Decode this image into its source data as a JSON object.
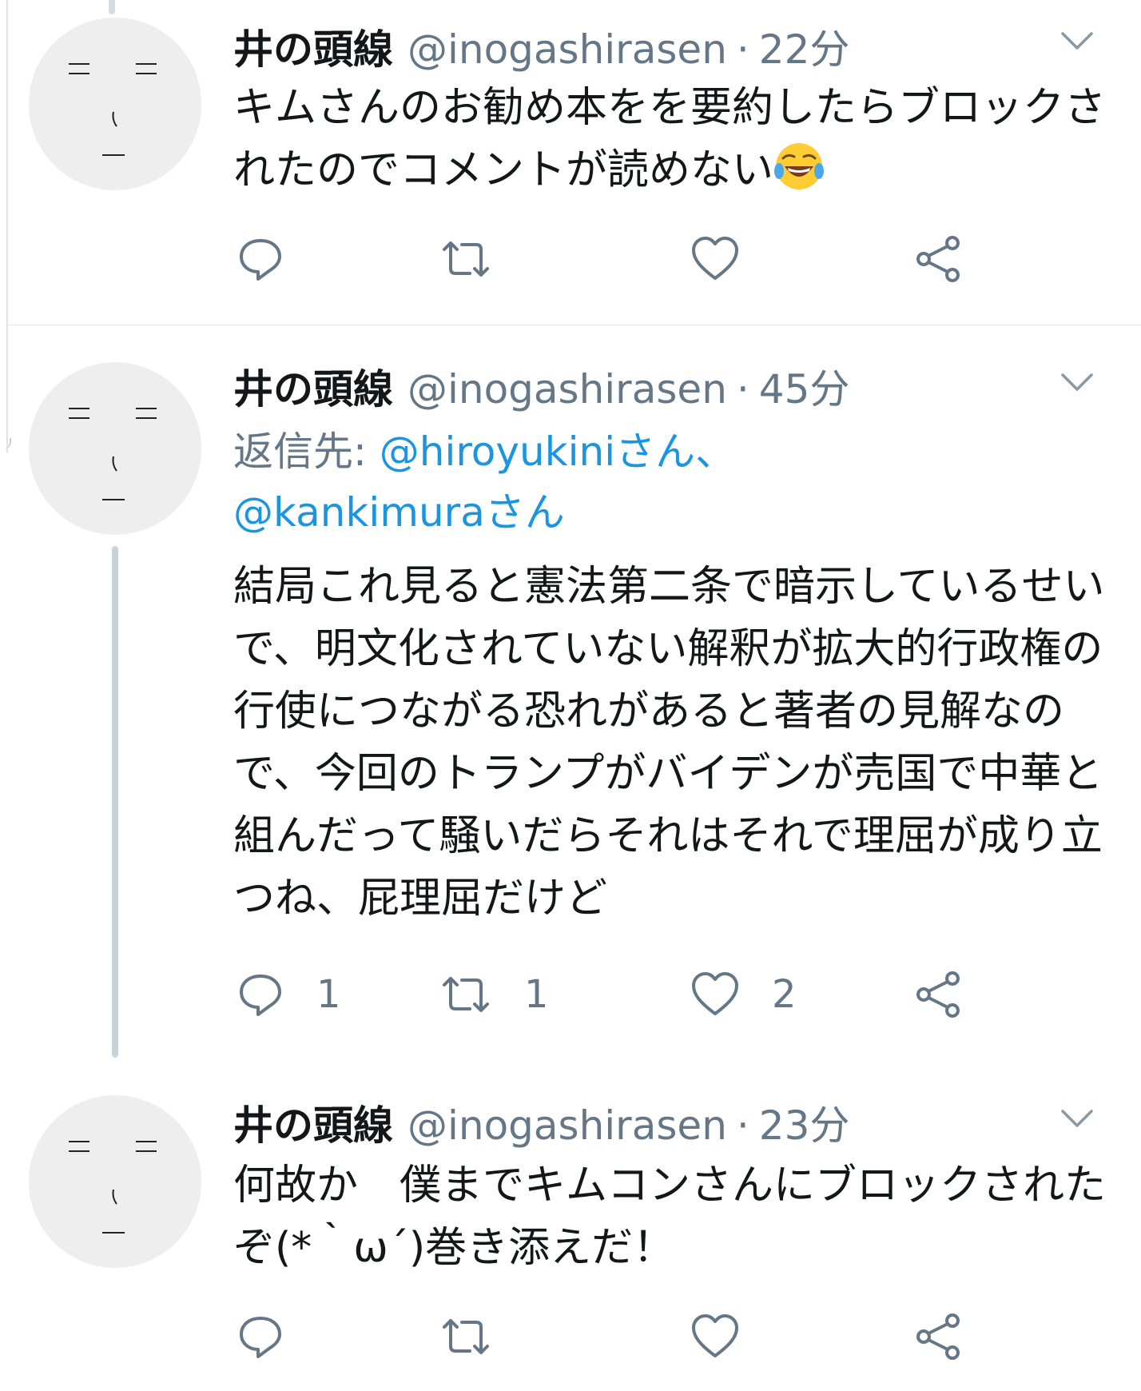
{
  "tweets": [
    {
      "name": "井の頭線",
      "handle": "@inogashirasen",
      "dot": "·",
      "time": "22分",
      "text": "キムさんのお勧め本をを要約したらブロックされたのでコメントが読めない",
      "emoji": "face-with-tears-of-joy",
      "actions": {
        "reply": "",
        "retweet": "",
        "like": "",
        "share": ""
      }
    },
    {
      "name": "井の頭線",
      "handle": "@inogashirasen",
      "dot": "·",
      "time": "45分",
      "reply_prefix": "返信先: ",
      "reply_mention_1": "@hiroyukiniさん、",
      "reply_mention_2": "@kankimuraさん",
      "text": "結局これ見ると憲法第二条で暗示しているせいで、明文化されていない解釈が拡大的行政権の行使につながる恐れがあると著者の見解なので、今回のトランプがバイデンが売国で中華と組んだって騒いだらそれはそれで理屈が成り立つね、屁理屈だけど",
      "actions": {
        "reply": "1",
        "retweet": "1",
        "like": "2",
        "share": ""
      }
    },
    {
      "name": "井の頭線",
      "handle": "@inogashirasen",
      "dot": "·",
      "time": "23分",
      "text": "何故か　僕までキムコンさんにブロックされたぞ(*｀ω´)巻き添えだ！",
      "actions": {
        "reply": "",
        "retweet": "",
        "like": "",
        "share": ""
      }
    }
  ],
  "colors": {
    "secondary_text": "#657786",
    "link": "#1b95e0",
    "divider": "#dfe5ea",
    "thread_line": "#c8d3dc"
  }
}
